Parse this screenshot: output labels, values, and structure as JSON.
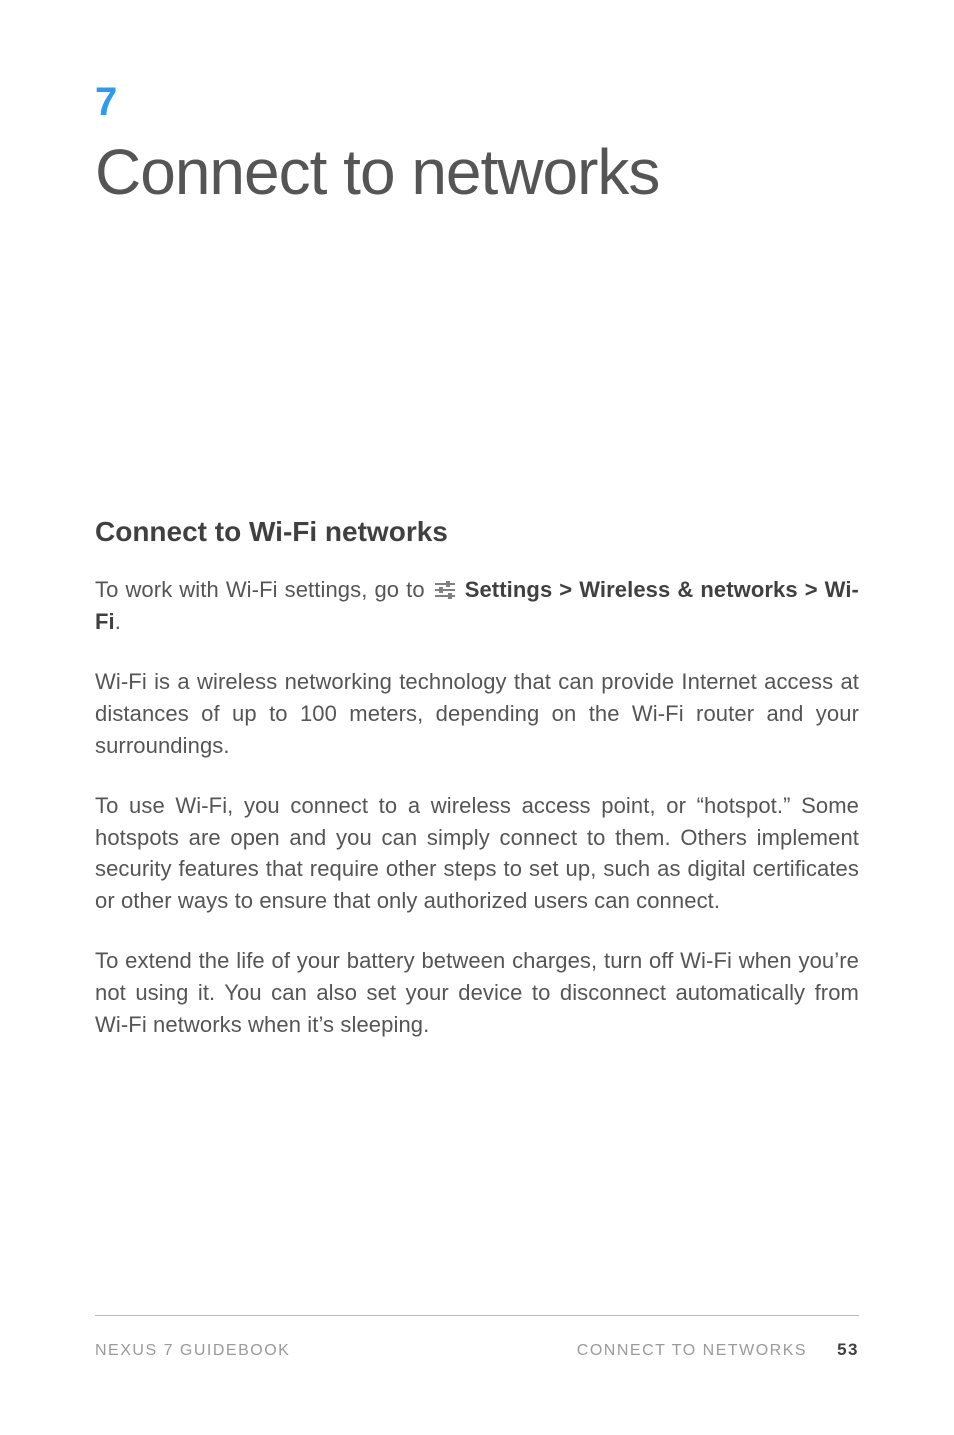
{
  "chapter": {
    "number": "7",
    "title": "Connect to networks"
  },
  "section": {
    "heading": "Connect to Wi-Fi networks"
  },
  "paragraphs": {
    "p1_a": "To work with Wi-Fi settings, go to ",
    "p1_b_bold": "Settings > Wireless & networks > Wi-Fi",
    "p1_c": ".",
    "p2": "Wi-Fi is a wireless networking technology that can provide Internet access at distances of up to 100 meters, depending on the Wi-Fi router and your surroundings.",
    "p3": "To use Wi-Fi, you connect to a wireless access point, or “hotspot.” Some hotspots are open and you can simply connect to them. Others implement security features that require other steps to set up, such as digital certificates or other ways to ensure that only authorized users can connect.",
    "p4": "To extend the life of your battery between charges, turn off Wi-Fi when you’re not using it. You can also set your device to disconnect automatically from Wi-Fi networks when it’s sleeping."
  },
  "footer": {
    "left": "NEXUS 7 GUIDEBOOK",
    "right_label": "CONNECT TO NETWORKS",
    "page_number": "53"
  },
  "icons": {
    "settings": "settings-sliders-icon"
  }
}
